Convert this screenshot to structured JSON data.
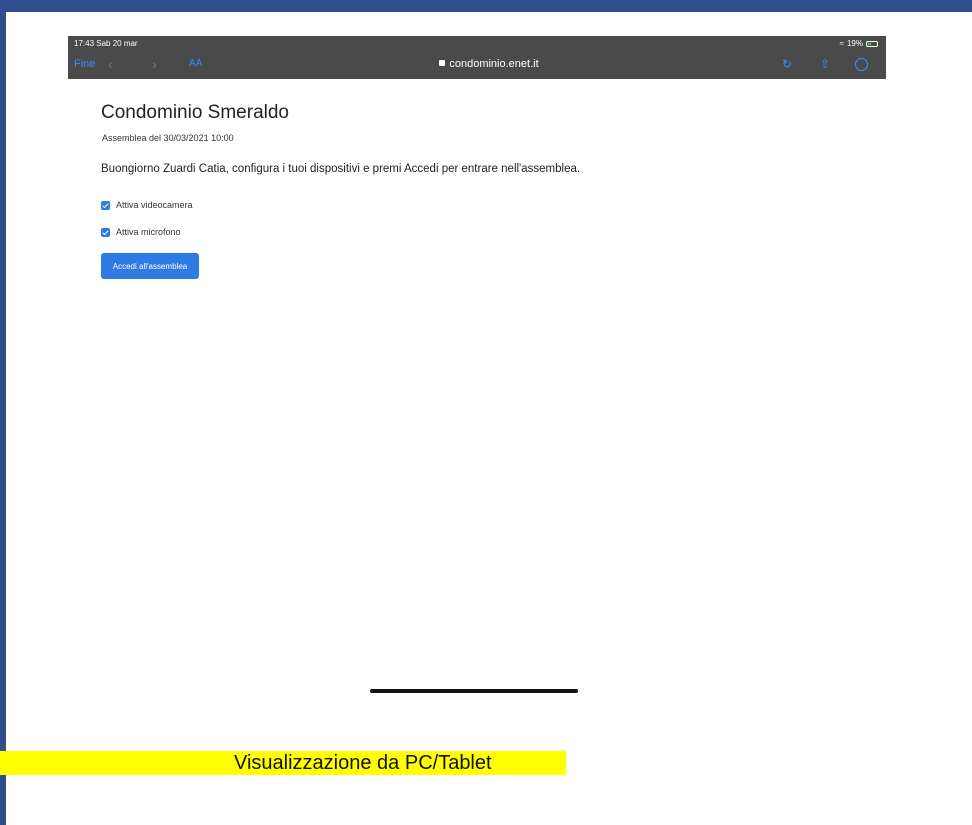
{
  "status_bar": {
    "time_date": "17:43  Sab 20 mar",
    "battery": "19%"
  },
  "browser": {
    "done_label": "Fine",
    "back_icon": "chevron-left-icon",
    "forward_icon": "chevron-right-icon",
    "text_size_label": "AA",
    "url": "condominio.enet.it"
  },
  "page": {
    "title": "Condominio Smeraldo",
    "meeting_date": "Assemblea del 30/03/2021 10:00",
    "greeting": "Buongiorno Zuardi Catia, configura i tuoi dispositivi e premi Accedi per entrare nell'assemblea.",
    "camera_label": "Attiva videocamera",
    "microphone_label": "Attiva microfono",
    "enter_button": "Accedi all'assemblea"
  },
  "caption": "Visualizzazione da PC/Tablet",
  "colors": {
    "frame": "#2f4f8f",
    "browser_bar": "#4a4a4a",
    "accent_blue": "#2f7be5",
    "caption_highlight": "#ffff00"
  }
}
